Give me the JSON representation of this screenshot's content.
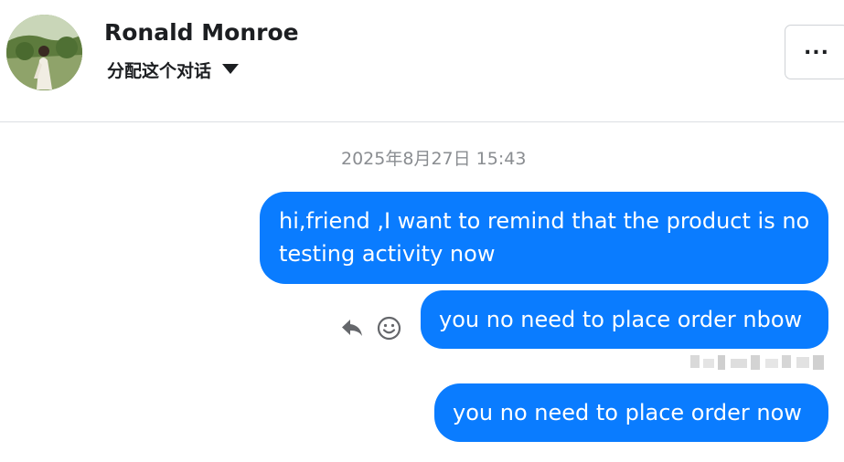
{
  "header": {
    "contact_name": "Ronald Monroe",
    "assign_label": "分配这个对话",
    "more_label": "...",
    "avatar_icon": "profile-photo"
  },
  "conversation": {
    "timestamp": "2025年8月27日 15:43",
    "messages": [
      {
        "text": "hi,friend ,I want to remind that the product is no testing activity now",
        "direction": "outgoing"
      },
      {
        "text": "you no need to place order nbow",
        "direction": "outgoing"
      },
      {
        "text": "you no need to place order now",
        "direction": "outgoing"
      }
    ],
    "message_actions": {
      "reply_icon": "reply-arrow-icon",
      "emoji_icon": "smiley-icon"
    }
  },
  "colors": {
    "bubble": "#0a7cff",
    "bubble_text": "#ffffff",
    "timestamp": "#8a8d91",
    "name": "#1c1e21",
    "divider": "#dcdfe3"
  }
}
